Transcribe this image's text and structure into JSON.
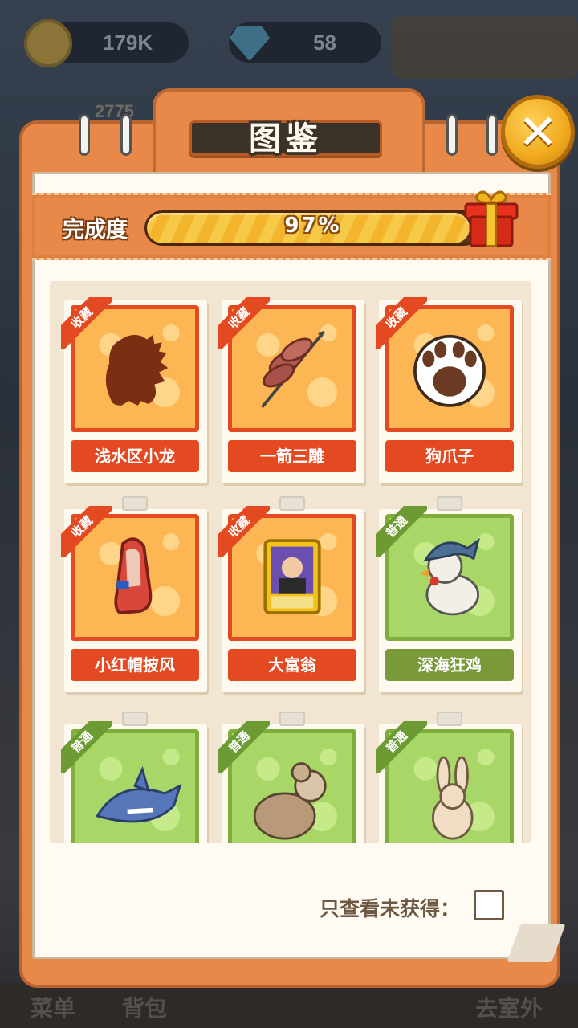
{
  "hud": {
    "coins": "179K",
    "gems": "58",
    "score": "2775",
    "bottom_buttons": [
      "菜单",
      "背包",
      "去室外"
    ]
  },
  "dialog": {
    "title": "图鉴",
    "close_icon": "close-icon",
    "progress_label": "完成度",
    "progress_text": "97%",
    "progress_value": 0.97,
    "gift_icon": "gift-box-icon",
    "filter_label": "只查看未获得：",
    "filter_checked": false
  },
  "items": [
    {
      "name": "浅水区小龙",
      "tag": "收藏",
      "rarity": "collect",
      "icon": "dragon-silhouette-icon"
    },
    {
      "name": "一箭三雕",
      "tag": "收藏",
      "rarity": "collect",
      "icon": "arrow-birds-icon"
    },
    {
      "name": "狗爪子",
      "tag": "收藏",
      "rarity": "collect",
      "icon": "dog-paw-icon"
    },
    {
      "name": "小红帽披风",
      "tag": "收藏",
      "rarity": "collect",
      "icon": "red-cape-icon"
    },
    {
      "name": "大富翁",
      "tag": "收藏",
      "rarity": "collect",
      "icon": "tycoon-card-icon"
    },
    {
      "name": "深海狂鸡",
      "tag": "普通",
      "rarity": "normal",
      "icon": "shark-hat-chicken-icon"
    },
    {
      "name": "",
      "tag": "普通",
      "rarity": "normal",
      "icon": "shark-icon"
    },
    {
      "name": "",
      "tag": "普通",
      "rarity": "normal",
      "icon": "sheep-icon"
    },
    {
      "name": "",
      "tag": "普通",
      "rarity": "normal",
      "icon": "rabbit-icon"
    }
  ],
  "colors": {
    "panel": "#e8894a",
    "collect": "#e34a21",
    "normal": "#7a9a3a",
    "gold": "#f7c948"
  }
}
